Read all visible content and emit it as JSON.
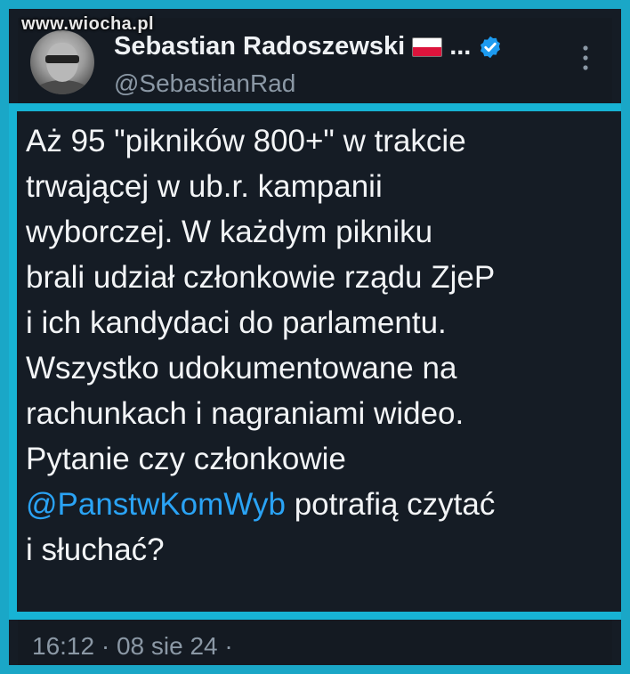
{
  "watermark": "www.wiocha.pl",
  "author": {
    "name": "Sebastian Radoszewski",
    "ellipsis": "...",
    "handle": "@SebastianRad"
  },
  "tweet": {
    "lines": [
      "Aż 95 \"pikników 800+\" w trakcie",
      "trwającej w ub.r. kampanii",
      "wyborczej. W każdym pikniku",
      "brali udział członkowie rządu ZjeP",
      "i ich kandydaci do parlamentu.",
      "Wszystko udokumentowane na",
      "rachunkach i nagraniami wideo.",
      "Pytanie czy członkowie"
    ],
    "mention": "@PanstwKomWyb",
    "after_mention": " potrafią czytać",
    "last_line": "i słuchać?"
  },
  "footer": {
    "timestamp": "16:12 · 08 sie 24 ·"
  },
  "colors": {
    "border": "#17b3d4",
    "mention": "#2aa3f5",
    "verified": "#1d9bf0"
  },
  "icons": {
    "flag": "poland-flag-icon",
    "verified": "verified-badge-icon",
    "more": "more-options-icon"
  }
}
